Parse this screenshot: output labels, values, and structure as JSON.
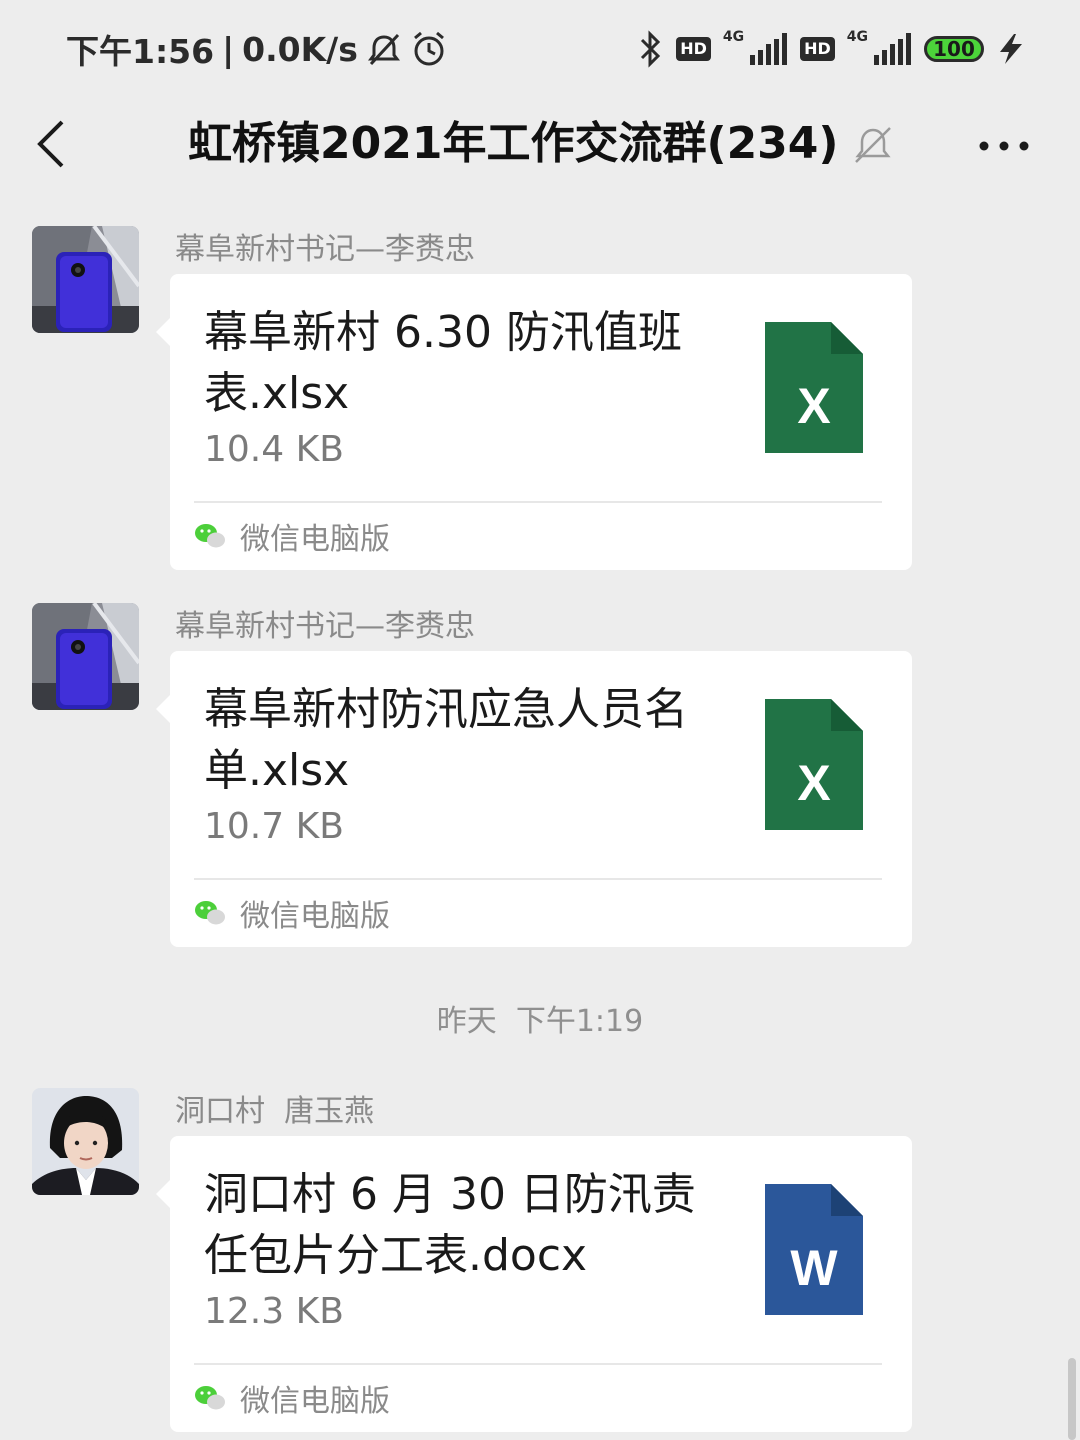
{
  "status_bar": {
    "time": "下午1:56",
    "separator": "|",
    "speed": "0.0K/s",
    "hd1": "HD",
    "net1": "4G",
    "hd2": "HD",
    "net2": "4G",
    "battery": "100"
  },
  "header": {
    "title": "虹桥镇2021年工作交流群(234)"
  },
  "messages": [
    {
      "sender": "幕阜新村书记—李赉忠",
      "file_name": "幕阜新村 6.30 防汛值班表.xlsx",
      "file_size": "10.4 KB",
      "file_icon_letter": "X",
      "file_icon_color": "#217346",
      "source": "微信电脑版"
    },
    {
      "sender": "幕阜新村书记—李赉忠",
      "file_name": "幕阜新村防汛应急人员名单.xlsx",
      "file_size": "10.7 KB",
      "file_icon_letter": "X",
      "file_icon_color": "#217346",
      "source": "微信电脑版"
    },
    {
      "sender": "洞口村  唐玉燕",
      "file_name": "洞口村 6 月 30 日防汛责任包片分工表.docx",
      "file_size": "12.3 KB",
      "file_icon_letter": "W",
      "file_icon_color": "#2b579a",
      "source": "微信电脑版"
    }
  ],
  "timestamp": "昨天  下午1:19",
  "colors": {
    "background": "#ededed",
    "bubble": "#ffffff",
    "excel": "#217346",
    "word": "#2b579a",
    "wechat_green": "#4ccf3a"
  }
}
